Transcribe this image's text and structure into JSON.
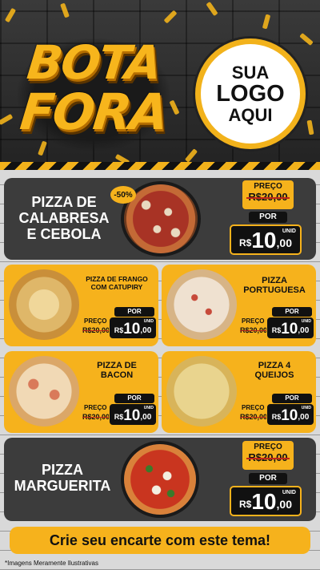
{
  "header": {
    "title_line1": "BOTA",
    "title_line2": "FORA",
    "logo_line1": "SUA",
    "logo_line2": "LOGO",
    "logo_line3": "AQUI"
  },
  "colors": {
    "accent": "#f6b21c",
    "dark": "#3c3c3c",
    "strike": "#c0261b"
  },
  "products": [
    {
      "name_line1": "PIZZA DE",
      "name_line2": "CALABRESA",
      "name_line3": "E CEBOLA",
      "discount": "-50%",
      "old_label": "PREÇO",
      "old_price": "R$20,00",
      "por_label": "POR",
      "currency": "R$",
      "price_int": "10",
      "price_dec": ",00",
      "unit": "UNID"
    },
    {
      "name_line1": "PIZZA DE FRANGO",
      "name_line2": "COM CATUPIRY",
      "old_label": "PREÇO",
      "old_price": "R$20,00",
      "por_label": "POR",
      "currency": "R$",
      "price_int": "10",
      "price_dec": ",00",
      "unit": "UNID"
    },
    {
      "name_line1": "PIZZA",
      "name_line2": "PORTUGUESA",
      "old_label": "PREÇO",
      "old_price": "R$20,00",
      "por_label": "POR",
      "currency": "R$",
      "price_int": "10",
      "price_dec": ",00",
      "unit": "UNID"
    },
    {
      "name_line1": "PIZZA DE",
      "name_line2": "BACON",
      "old_label": "PREÇO",
      "old_price": "R$20,00",
      "por_label": "POR",
      "currency": "R$",
      "price_int": "10",
      "price_dec": ",00",
      "unit": "UNID"
    },
    {
      "name_line1": "PIZZA 4",
      "name_line2": "QUEIJOS",
      "old_label": "PREÇO",
      "old_price": "R$20,00",
      "por_label": "POR",
      "currency": "R$",
      "price_int": "10",
      "price_dec": ",00",
      "unit": "UNID"
    },
    {
      "name_line1": "PIZZA",
      "name_line2": "MARGUERITA",
      "old_label": "PREÇO",
      "old_price": "R$20,00",
      "por_label": "POR",
      "currency": "R$",
      "price_int": "10",
      "price_dec": ",00",
      "unit": "UNID"
    }
  ],
  "footer": {
    "cta": "Crie seu encarte com este tema!",
    "disclaimer": "*Imagens Meramente Ilustrativas"
  }
}
